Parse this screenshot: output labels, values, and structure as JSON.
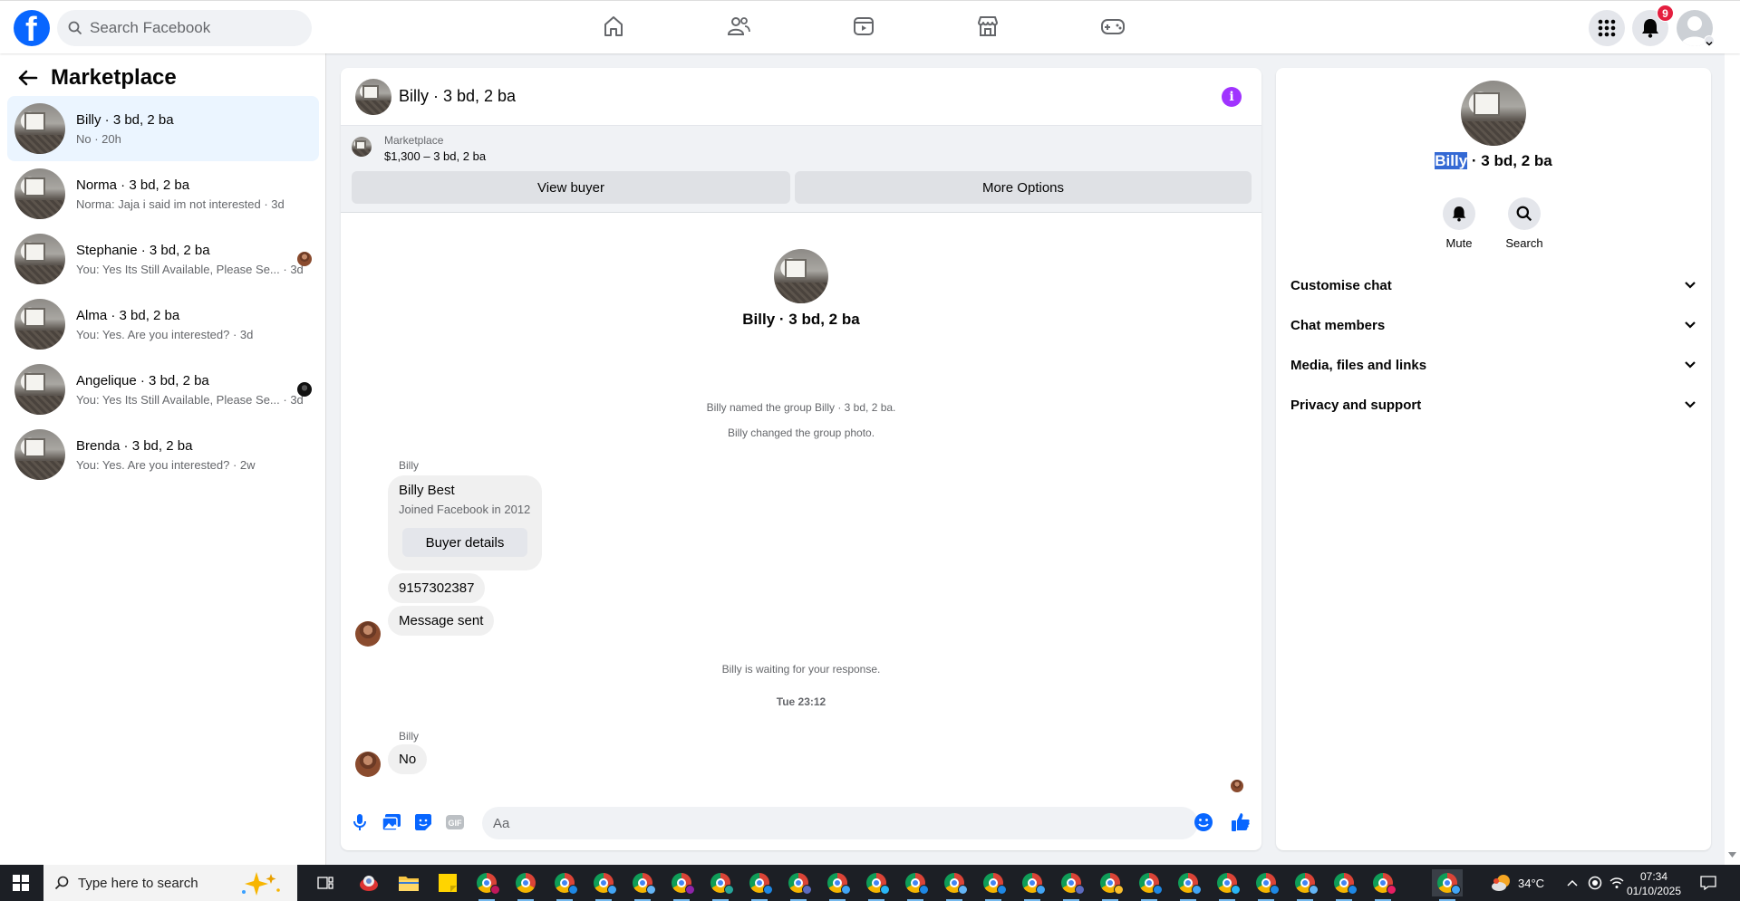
{
  "topbar": {
    "search_placeholder": "Search Facebook",
    "notification_count": "9"
  },
  "left": {
    "title": "Marketplace",
    "conversations": [
      {
        "name": "Billy · 3 bd, 2 ba",
        "preview": "No · 20h",
        "active": true
      },
      {
        "name": "Norma · 3 bd, 2 ba",
        "preview": "Norma: Jaja i said im not interested · 3d"
      },
      {
        "name": "Stephanie · 3 bd, 2 ba",
        "preview": "You: Yes Its Still Available, Please Se... · 3d"
      },
      {
        "name": "Alma · 3 bd, 2 ba",
        "preview": "You: Yes. Are you interested? · 3d"
      },
      {
        "name": "Angelique · 3 bd, 2 ba",
        "preview": "You: Yes Its Still Available, Please Se... · 3d"
      },
      {
        "name": "Brenda · 3 bd, 2 ba",
        "preview": "You: Yes. Are you interested? · 2w"
      }
    ]
  },
  "chat": {
    "title": "Billy · 3 bd, 2 ba",
    "listing_source": "Marketplace",
    "listing_price": "$1,300 – 3 bd, 2 ba",
    "view_buyer": "View buyer",
    "more_options": "More Options",
    "hero_name": "Billy · 3 bd, 2 ba",
    "sys_named": "Billy named the group Billy · 3 bd, 2 ba.",
    "sys_photo": "Billy changed the group photo.",
    "sender_1": "Billy",
    "card_name": "Billy Best",
    "card_sub": "Joined Facebook in 2012",
    "card_button": "Buyer details",
    "msg_phone": "9157302387",
    "msg_sent": "Message sent",
    "waiting": "Billy is waiting for your response.",
    "timestamp": "Tue 23:12",
    "sender_2": "Billy",
    "msg_no": "No",
    "composer_placeholder": "Aa"
  },
  "right": {
    "name_highlight": "Billy",
    "name_rest": " · 3 bd, 2 ba",
    "mute": "Mute",
    "search": "Search",
    "sections": [
      "Customise chat",
      "Chat members",
      "Media, files and links",
      "Privacy and support"
    ]
  },
  "taskbar": {
    "search_placeholder": "Type here to search",
    "temperature": "34°C",
    "time": "07:34",
    "date": "01/10/2025"
  },
  "colors": {
    "brand": "#0866ff",
    "active_row": "#ebf5ff",
    "info": "#a033ff",
    "badge": "#e41e3f",
    "selection": "#3469d4"
  }
}
